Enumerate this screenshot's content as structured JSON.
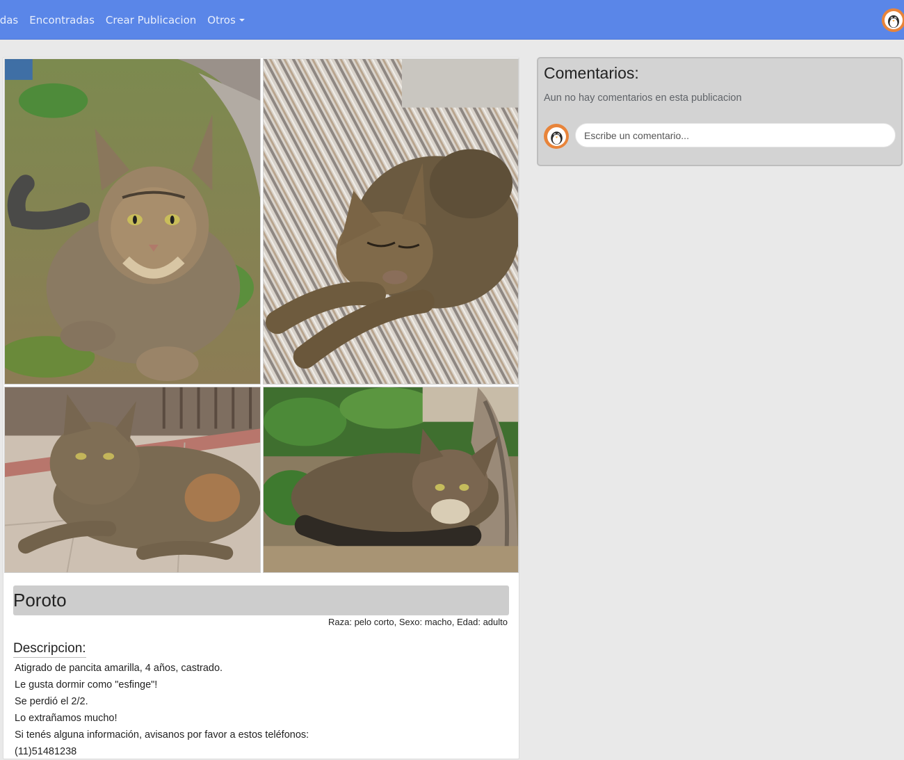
{
  "nav": {
    "links": [
      {
        "label": "didas"
      },
      {
        "label": "Encontradas"
      },
      {
        "label": "Crear Publicacion"
      },
      {
        "label": "Otros"
      }
    ]
  },
  "colors": {
    "navbar": "#5a86e8",
    "avatar_ring": "#e8843a",
    "background": "#e9e9e9"
  },
  "post": {
    "photos": [
      {
        "icon": "cat-photo-grass"
      },
      {
        "icon": "cat-photo-bed"
      },
      {
        "icon": "cat-photo-floor"
      },
      {
        "icon": "cat-photo-garden"
      }
    ],
    "name": "Poroto",
    "meta": "Raza: pelo corto, Sexo: macho, Edad: adulto",
    "description_title": "Descripcion:",
    "description_lines": [
      "Atigrado de pancita amarilla, 4 años, castrado.",
      "Le gusta dormir como \"esfinge\"!",
      "Se perdió el 2/2.",
      "Lo extrañamos mucho!",
      "Si tenés alguna información, avisanos por favor a estos teléfonos:",
      "(11)51481238"
    ]
  },
  "comments": {
    "title": "Comentarios:",
    "empty_text": "Aun no hay comentarios en esta publicacion",
    "input_placeholder": "Escribe un comentario..."
  }
}
